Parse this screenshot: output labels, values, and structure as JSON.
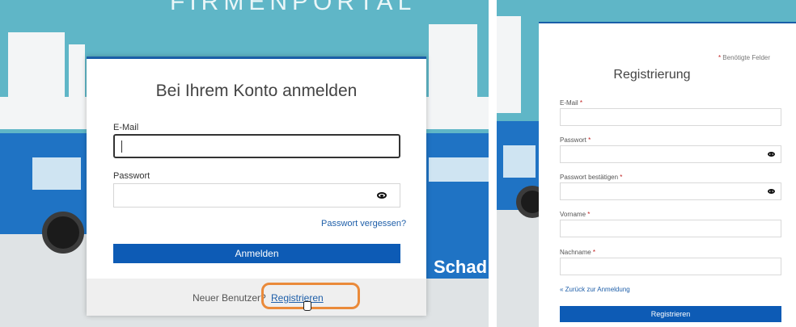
{
  "login": {
    "banner_text": "FIRMENPORTAL",
    "side_text": "Schad",
    "title": "Bei Ihrem Konto anmelden",
    "email_label": "E-Mail",
    "email_value": "",
    "password_label": "Passwort",
    "password_value": "",
    "forgot_password": "Passwort vergessen?",
    "submit_label": "Anmelden",
    "new_user_text": "Neuer Benutzer?",
    "register_link": "Registrieren"
  },
  "register": {
    "required_note": "Benötigte Felder",
    "required_marker": "*",
    "title": "Registrierung",
    "fields": [
      {
        "label": "E-Mail",
        "value": "",
        "password": false
      },
      {
        "label": "Passwort",
        "value": "",
        "password": true
      },
      {
        "label": "Passwort bestätigen",
        "value": "",
        "password": true
      },
      {
        "label": "Vorname",
        "value": "",
        "password": false
      },
      {
        "label": "Nachname",
        "value": "",
        "password": false
      }
    ],
    "back_link": "« Zurück zur Anmeldung",
    "submit_label": "Registrieren"
  },
  "colors": {
    "primary": "#0d5bb5",
    "link": "#1f5fa9",
    "highlight": "#ea8a3a",
    "required": "#c02020"
  }
}
